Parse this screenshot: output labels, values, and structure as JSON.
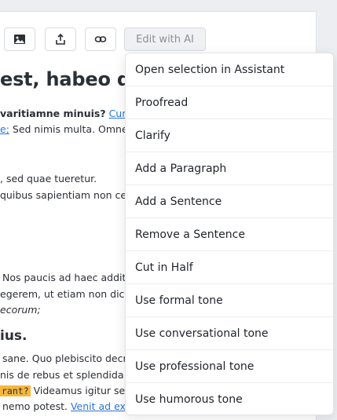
{
  "toolbar": {
    "icons": [
      "image-icon",
      "share-upload-icon",
      "link-icon"
    ],
    "ai_button_label": "Edit with AI"
  },
  "document": {
    "heading1": "est, habeo qu",
    "p1_bold": "varitiamne minuis?",
    "p1_link": "Cur iu",
    "p1b_link": "e;",
    "p1b_text": "Sed nimis multa. Omnes",
    "p2_line1": ", sed quae tueretur.",
    "p2_line2": "quibus sapientiam non cern",
    "p3_line1": "Nos paucis ad haec additi",
    "p3_line2": "egerem, ut etiam non dice",
    "p3_line3": "ecorum;",
    "heading2": "ius.",
    "p4_line1": "sane. Quo plebiscito decre",
    "p4_line2": "nis de rebus et splendida es",
    "p4_mark": "rant?",
    "p4_line3_text": "Videamus igitur sen",
    "p4_line4_text": "nemo potest.",
    "p4_line4_link": "Venit ad ext"
  },
  "menu": {
    "items": [
      "Open selection in Assistant",
      "Proofread",
      "Clarify",
      "Add a Paragraph",
      "Add a Sentence",
      "Remove a Sentence",
      "Cut in Half",
      "Use formal tone",
      "Use conversational tone",
      "Use professional tone",
      "Use humorous tone"
    ]
  }
}
